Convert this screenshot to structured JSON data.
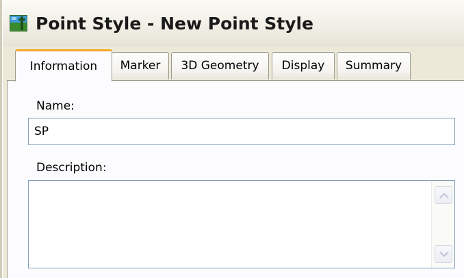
{
  "window": {
    "title": "Point Style - New Point Style",
    "icon": "point-style-icon"
  },
  "tabs": [
    {
      "label": "Information",
      "active": true
    },
    {
      "label": "Marker",
      "active": false
    },
    {
      "label": "3D Geometry",
      "active": false
    },
    {
      "label": "Display",
      "active": false
    },
    {
      "label": "Summary",
      "active": false
    }
  ],
  "form": {
    "name_label": "Name:",
    "name_value": "SP",
    "description_label": "Description:",
    "description_value": ""
  },
  "colors": {
    "active_tab_accent": "#f5a623",
    "input_border": "#7f9db9",
    "window_bg": "#ece9d8"
  }
}
